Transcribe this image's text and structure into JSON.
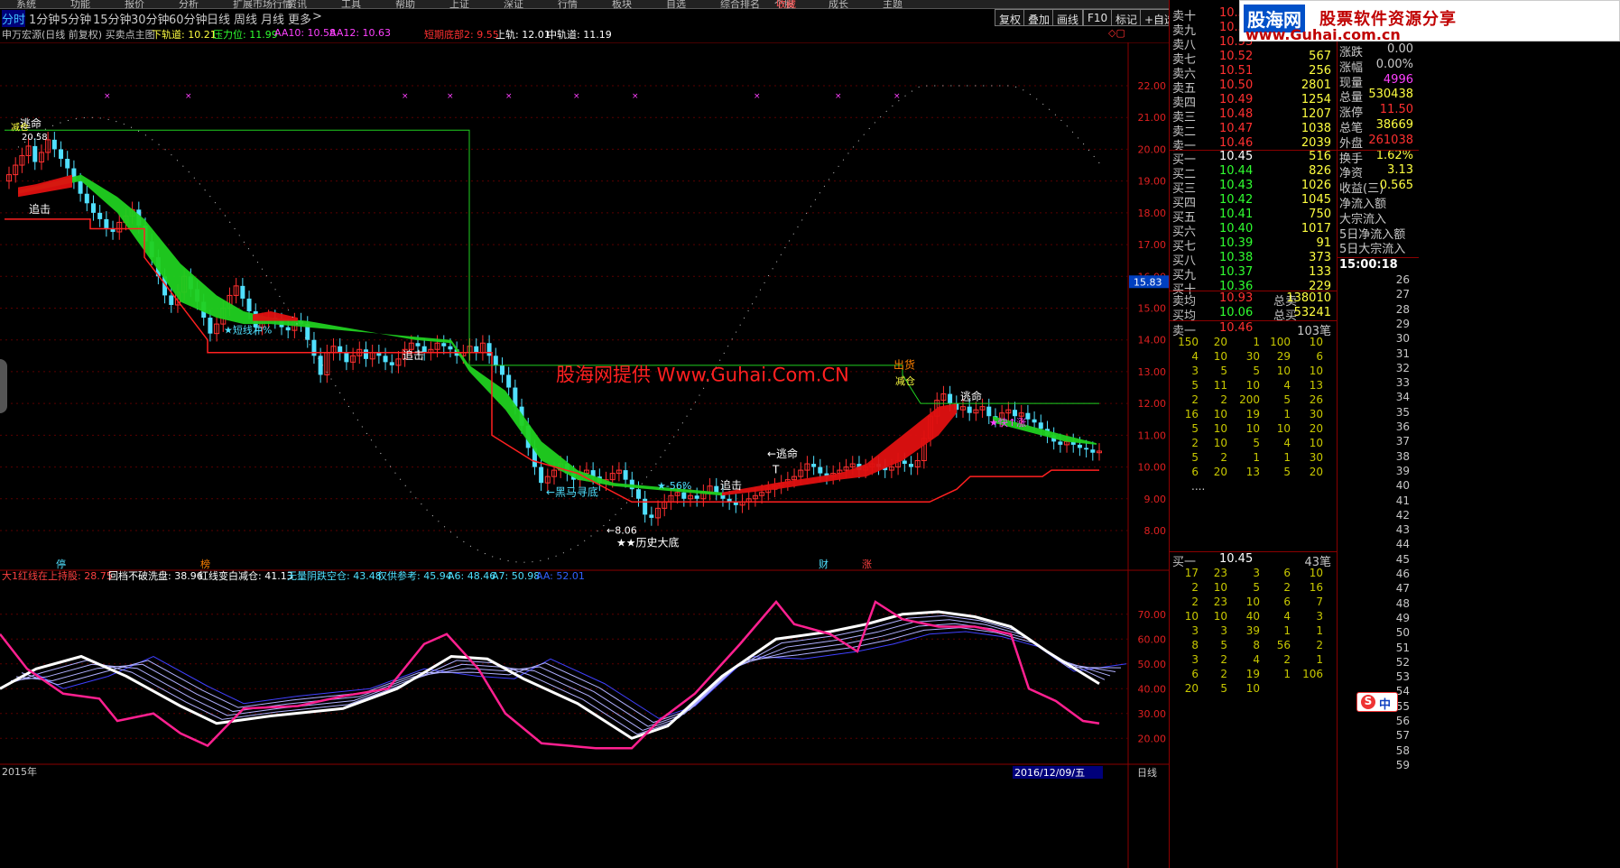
{
  "menu_items": [
    "系统",
    "功能",
    "报价",
    "分析",
    "扩展市场行情",
    "资讯",
    "工具",
    "帮助",
    "上证",
    "深证",
    "行情",
    "板块",
    "自选",
    "综合排名",
    "个股",
    "成长",
    "主题"
  ],
  "menu_highlight": "收藏",
  "toolbar": {
    "periods": [
      "分时",
      "1分钟",
      "5分钟",
      "15分钟",
      "30分钟",
      "60分钟",
      "日线",
      "周线",
      "月线",
      "更多"
    ],
    "active_period": "分时",
    "more_arrow": ">",
    "buttons": [
      "复权",
      "叠加",
      "画线",
      "F10",
      "标记",
      "+自选"
    ]
  },
  "info": {
    "stock": "申万宏源(日线 前复权) 买卖点主图",
    "lower_track": "下轨道: 10.21",
    "pressure": "压力位: 11.99",
    "aa10": "AA10: 10.58",
    "aa12": "AA12: 10.63",
    "short_bottom": "短期底部2: 9.55",
    "upper_track": "上轨: 12.01",
    "mid_track": "中轨道: 11.19"
  },
  "main_chart": {
    "y_ticks": [
      "22.00",
      "21.00",
      "20.00",
      "19.00",
      "18.00",
      "17.00",
      "16.00",
      "15.00",
      "14.00",
      "13.00",
      "12.00",
      "11.00",
      "10.00",
      "9.00",
      "8.00"
    ],
    "price_marker": "15.83",
    "labels": {
      "escape1": "逃命",
      "reduce1": "减仓",
      "high_price": "20.58",
      "chase1": "追击",
      "short_line": "★短线冲%",
      "chase2": "追击",
      "dark_horse": "←黑马寻底",
      "low_price": "←8.06",
      "hist_bottom": "★★历史大底",
      "line56": "★-56%",
      "chase3": "追击",
      "escape2": "←逃命",
      "t_mark": "T",
      "sell": "出货",
      "reduce2": "减仓",
      "escape3": "逃命",
      "quick": "★快↑涨",
      "watermark": "股海网提供 Www.Guhai.Com.CN"
    },
    "event_marks": [
      "停",
      "榜",
      "财",
      "涨"
    ]
  },
  "indicator": {
    "name": "大1",
    "l1": "红线在上持股: 28.75",
    "l2": "回档不破洗盘: 38.96",
    "l3": "红线变白减仓: 41.13",
    "l4": "无量阴跌空仓: 43.48",
    "l5": "仅供参考: 45.94",
    "l6": "A6: 48.46",
    "l7": "A7: 50.98",
    "l8": "AA: 52.01",
    "y_ticks": [
      "70.00",
      "60.00",
      "50.00",
      "40.00",
      "30.00",
      "20.00"
    ]
  },
  "date_bar": {
    "left": "2015年",
    "mid": "2016/12/09/五",
    "right": "日线"
  },
  "quote": {
    "sells": [
      {
        "label": "卖十",
        "price": "10.55",
        "vol": "",
        "color": "#ff3030"
      },
      {
        "label": "卖九",
        "price": "10.54",
        "vol": "",
        "color": "#ff3030"
      },
      {
        "label": "卖八",
        "price": "10.53",
        "vol": "",
        "color": "#ff3030"
      },
      {
        "label": "卖七",
        "price": "10.52",
        "vol": "567",
        "color": "#ff3030"
      },
      {
        "label": "卖六",
        "price": "10.51",
        "vol": "256",
        "color": "#ff3030"
      },
      {
        "label": "卖五",
        "price": "10.50",
        "vol": "2801",
        "color": "#ff3030"
      },
      {
        "label": "卖四",
        "price": "10.49",
        "vol": "1254",
        "color": "#ff3030"
      },
      {
        "label": "卖三",
        "price": "10.48",
        "vol": "1207",
        "color": "#ff3030"
      },
      {
        "label": "卖二",
        "price": "10.47",
        "vol": "1038",
        "color": "#ff3030"
      },
      {
        "label": "卖一",
        "price": "10.46",
        "vol": "2039",
        "color": "#ff3030"
      }
    ],
    "buys": [
      {
        "label": "买一",
        "price": "10.45",
        "vol": "516",
        "color": "#ffffff"
      },
      {
        "label": "买二",
        "price": "10.44",
        "vol": "826",
        "color": "#30ff30"
      },
      {
        "label": "买三",
        "price": "10.43",
        "vol": "1026",
        "color": "#30ff30"
      },
      {
        "label": "买四",
        "price": "10.42",
        "vol": "1045",
        "color": "#30ff30"
      },
      {
        "label": "买五",
        "price": "10.41",
        "vol": "750",
        "color": "#30ff30"
      },
      {
        "label": "买六",
        "price": "10.40",
        "vol": "1017",
        "color": "#30ff30"
      },
      {
        "label": "买七",
        "price": "10.39",
        "vol": "91",
        "color": "#30ff30"
      },
      {
        "label": "买八",
        "price": "10.38",
        "vol": "373",
        "color": "#30ff30"
      },
      {
        "label": "买九",
        "price": "10.37",
        "vol": "133",
        "color": "#30ff30"
      },
      {
        "label": "买十",
        "price": "10.36",
        "vol": "229",
        "color": "#30ff30"
      }
    ],
    "avg_sell_label": "卖均",
    "avg_sell": "10.93",
    "total_sell_label": "总卖",
    "total_sell": "138010",
    "avg_buy_label": "买均",
    "avg_buy": "10.06",
    "total_buy_label": "总买",
    "total_buy": "53241",
    "sell1_label": "卖一",
    "sell1_price": "10.46",
    "sell1_count": "103笔",
    "sell1_queue": [
      [
        "150",
        "20",
        "1",
        "100",
        "10"
      ],
      [
        "4",
        "10",
        "30",
        "29",
        "6"
      ],
      [
        "3",
        "5",
        "5",
        "10",
        "10"
      ],
      [
        "5",
        "11",
        "10",
        "4",
        "13"
      ],
      [
        "2",
        "2",
        "200",
        "5",
        "26"
      ],
      [
        "16",
        "10",
        "19",
        "1",
        "30"
      ],
      [
        "5",
        "10",
        "10",
        "10",
        "20"
      ],
      [
        "2",
        "10",
        "5",
        "4",
        "10"
      ],
      [
        "5",
        "2",
        "1",
        "1",
        "30"
      ],
      [
        "6",
        "20",
        "13",
        "5",
        "20"
      ]
    ],
    "more": "....",
    "buy1_label": "买一",
    "buy1_price": "10.45",
    "buy1_count": "43笔",
    "buy1_queue": [
      [
        "17",
        "23",
        "3",
        "6",
        "10"
      ],
      [
        "2",
        "10",
        "5",
        "2",
        "16"
      ],
      [
        "2",
        "23",
        "10",
        "6",
        "7"
      ],
      [
        "10",
        "10",
        "40",
        "4",
        "3"
      ],
      [
        "3",
        "3",
        "39",
        "1",
        "1"
      ],
      [
        "8",
        "5",
        "8",
        "56",
        "2"
      ],
      [
        "3",
        "2",
        "4",
        "2",
        "1"
      ],
      [
        "6",
        "2",
        "19",
        "1",
        "106"
      ],
      [
        "20",
        "5",
        "10",
        "",
        ""
      ]
    ]
  },
  "stats": [
    {
      "label": "涨跌",
      "value": "0.00",
      "color": "#c8c8c8"
    },
    {
      "label": "涨幅",
      "value": "0.00%",
      "color": "#c8c8c8"
    },
    {
      "label": "现量",
      "value": "4996",
      "color": "#ff40ff"
    },
    {
      "label": "总量",
      "value": "530438",
      "color": "#ffff40"
    },
    {
      "label": "涨停",
      "value": "11.50",
      "color": "#ff3030"
    },
    {
      "label": "总笔",
      "value": "38669",
      "color": "#ffff40"
    },
    {
      "label": "外盘",
      "value": "261038",
      "color": "#ff3030"
    },
    {
      "label": "换手",
      "value": "1.62%",
      "color": "#ffff40"
    },
    {
      "label": "净资",
      "value": "3.13",
      "color": "#ffff40"
    },
    {
      "label": "收益(三)",
      "value": "0.565",
      "color": "#ffff40"
    },
    {
      "label": "净流入额",
      "value": "",
      "color": "#ffff40"
    },
    {
      "label": "大宗流入",
      "value": "",
      "color": "#ffff40"
    },
    {
      "label": "5日净流入额",
      "value": "",
      "color": "#ffff40"
    },
    {
      "label": "5日大宗流入",
      "value": "",
      "color": "#ffff40"
    }
  ],
  "time": "15:00:18",
  "time_list": [
    "26",
    "27",
    "28",
    "29",
    "30",
    "31",
    "32",
    "33",
    "34",
    "35",
    "36",
    "37",
    "38",
    "39",
    "40",
    "41",
    "42",
    "43",
    "44",
    "45",
    "46",
    "47",
    "48",
    "49",
    "50",
    "51",
    "52",
    "53",
    "54",
    "55",
    "56",
    "57",
    "58",
    "59"
  ],
  "banner": {
    "logo": "股海网",
    "slogan": "股票软件资源分享",
    "url": "www.Guhai.com.cn"
  },
  "ime": {
    "s": "S",
    "zh": "中"
  }
}
